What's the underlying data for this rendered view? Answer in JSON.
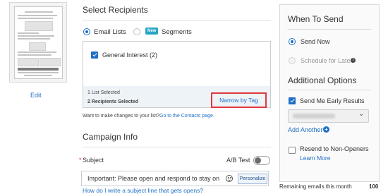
{
  "left": {
    "edit_label": "Edit"
  },
  "recipients": {
    "title": "Select Recipients",
    "option_email_lists": "Email Lists",
    "new_badge": "New",
    "option_segments": "Segments",
    "list_item": "General Interest (2)",
    "list_selected": "1 List Selected",
    "recipients_selected": "2 Recipients Selected",
    "narrow_by_tag": "Narrow by Tag",
    "change_prompt": "Want to make changes to your list?",
    "contacts_link": "Go to the Contacts page."
  },
  "campaign": {
    "title": "Campaign Info",
    "required_mark": "*",
    "subject_label": "Subject",
    "ab_test_label": "A/B Test",
    "subject_value": "Important: Please open and respond to stay on",
    "personalize_label": "Personalize",
    "help_link": "How do I write a subject line that gets opens?"
  },
  "when": {
    "title": "When To Send",
    "send_now": "Send Now",
    "schedule_later": "Schedule for Later",
    "info_glyph": "i"
  },
  "additional": {
    "title": "Additional Options",
    "early_results": "Send Me Early Results",
    "add_another": "Add Another",
    "add_glyph": "+",
    "resend_label": "Resend to Non-Openers",
    "learn_more": "Learn More",
    "dropdown_arrow": "⌄"
  },
  "footer": {
    "remaining_label": "Remaining emails this month",
    "remaining_value": "100"
  },
  "icons": {
    "emoji": "smiley-icon",
    "info": "info-icon",
    "add": "plus-circle-icon",
    "dropdown": "chevron-down-icon"
  },
  "colors": {
    "accent": "#1f6fc5",
    "highlight": "#e0393e",
    "new_badge": "#2aa5c4"
  }
}
